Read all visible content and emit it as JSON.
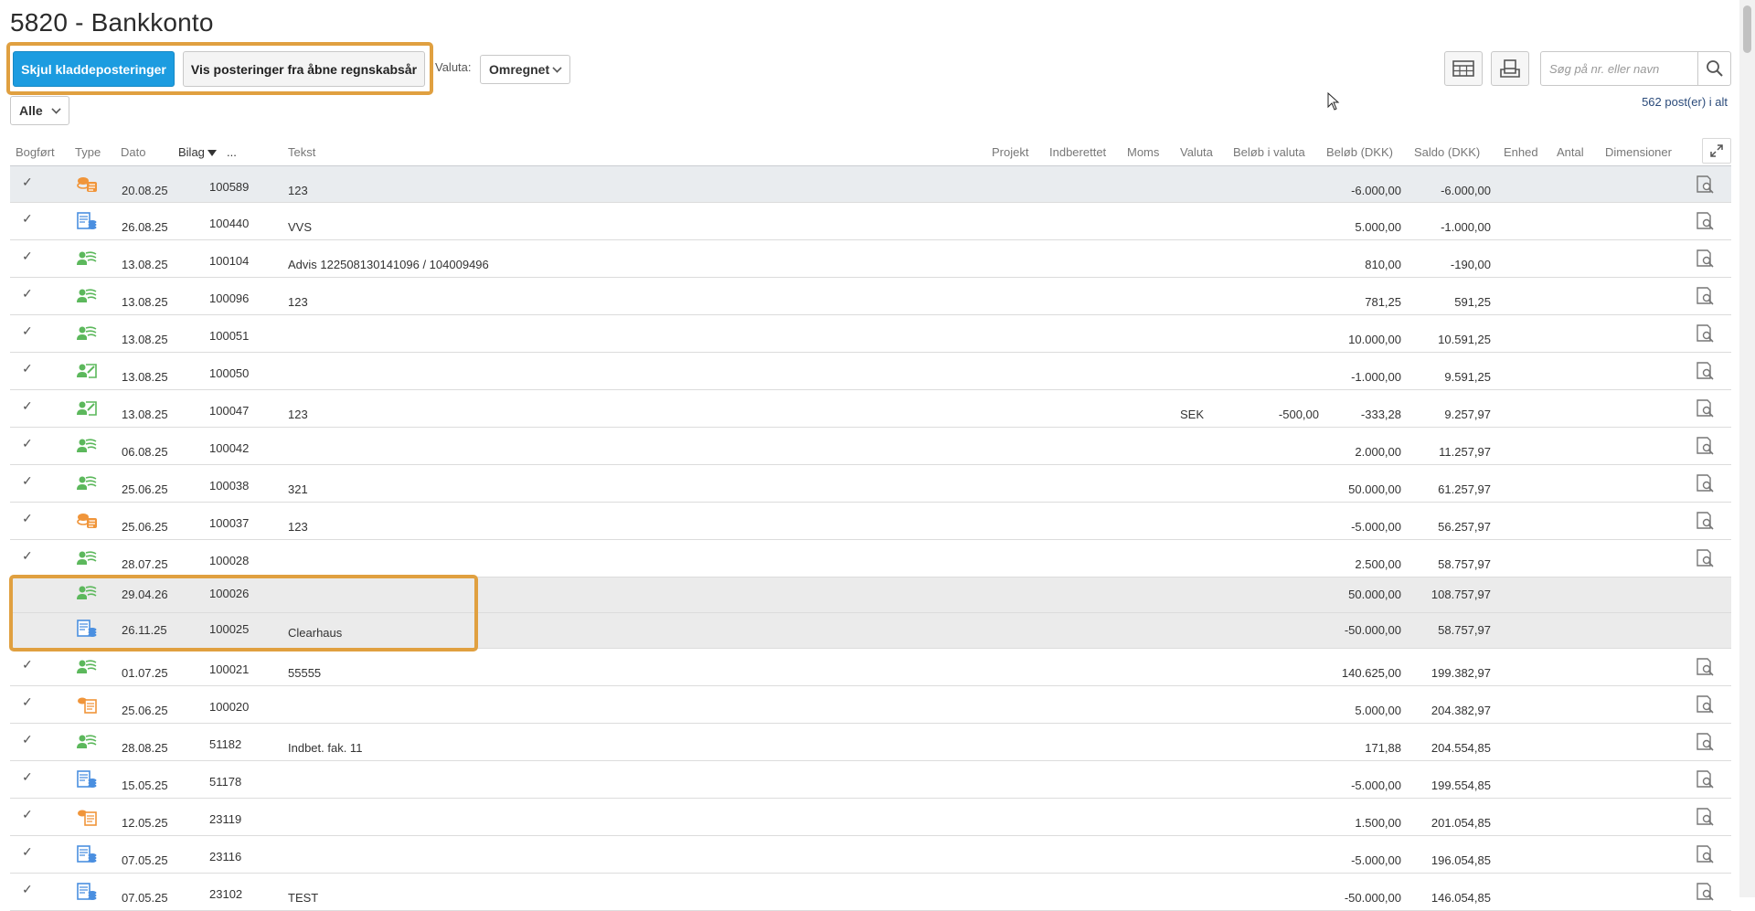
{
  "page": {
    "title": "5820 - Bankkonto"
  },
  "toolbar": {
    "hide_drafts_label": "Skjul kladdeposteringer",
    "show_open_years_label": "Vis posteringer fra åbne regnskabsår",
    "valuta_label": "Valuta:",
    "valuta_value": "Omregnet",
    "filter_value": "Alle",
    "search_placeholder": "Søg på nr. eller navn",
    "count_text": "562 post(er) i alt"
  },
  "columns": {
    "bogfort": "Bogført",
    "type": "Type",
    "dato": "Dato",
    "bilag": "Bilag",
    "more": "...",
    "tekst": "Tekst",
    "projekt": "Projekt",
    "indberettet": "Indberettet",
    "moms": "Moms",
    "valuta": "Valuta",
    "belob_valuta": "Beløb i valuta",
    "belob": "Beløb (DKK)",
    "saldo": "Saldo (DKK)",
    "enhed": "Enhed",
    "antal": "Antal",
    "dimensioner": "Dimensioner"
  },
  "rows": [
    {
      "check": "✓",
      "icon": "orange-coins-icon",
      "dato": "20.08.25",
      "bilag": "100589",
      "tekst": "123",
      "valuta": "",
      "belob_valuta": "",
      "belob": "-6.000,00",
      "saldo": "-6.000,00"
    },
    {
      "check": "✓",
      "icon": "blue-document-icon",
      "dato": "26.08.25",
      "bilag": "100440",
      "tekst": "VVS",
      "valuta": "",
      "belob_valuta": "",
      "belob": "5.000,00",
      "saldo": "-1.000,00"
    },
    {
      "check": "✓",
      "icon": "green-person-icon",
      "dato": "13.08.25",
      "bilag": "100104",
      "tekst": "Advis 122508130141096 / 104009496",
      "valuta": "",
      "belob_valuta": "",
      "belob": "810,00",
      "saldo": "-190,00"
    },
    {
      "check": "✓",
      "icon": "green-person-icon",
      "dato": "13.08.25",
      "bilag": "100096",
      "tekst": "123",
      "valuta": "",
      "belob_valuta": "",
      "belob": "781,25",
      "saldo": "591,25"
    },
    {
      "check": "✓",
      "icon": "green-person-icon",
      "dato": "13.08.25",
      "bilag": "100051",
      "tekst": "",
      "valuta": "",
      "belob_valuta": "",
      "belob": "10.000,00",
      "saldo": "10.591,25"
    },
    {
      "check": "✓",
      "icon": "green-edit-icon",
      "dato": "13.08.25",
      "bilag": "100050",
      "tekst": "",
      "valuta": "",
      "belob_valuta": "",
      "belob": "-1.000,00",
      "saldo": "9.591,25"
    },
    {
      "check": "✓",
      "icon": "green-edit-icon",
      "dato": "13.08.25",
      "bilag": "100047",
      "tekst": "123",
      "valuta": "SEK",
      "belob_valuta": "-500,00",
      "belob": "-333,28",
      "saldo": "9.257,97"
    },
    {
      "check": "✓",
      "icon": "green-person-icon",
      "dato": "06.08.25",
      "bilag": "100042",
      "tekst": "",
      "valuta": "",
      "belob_valuta": "",
      "belob": "2.000,00",
      "saldo": "11.257,97"
    },
    {
      "check": "✓",
      "icon": "green-person-icon",
      "dato": "25.06.25",
      "bilag": "100038",
      "tekst": "321",
      "valuta": "",
      "belob_valuta": "",
      "belob": "50.000,00",
      "saldo": "61.257,97"
    },
    {
      "check": "✓",
      "icon": "orange-coins-icon",
      "dato": "25.06.25",
      "bilag": "100037",
      "tekst": "123",
      "valuta": "",
      "belob_valuta": "",
      "belob": "-5.000,00",
      "saldo": "56.257,97"
    },
    {
      "check": "✓",
      "icon": "green-person-icon",
      "dato": "28.07.25",
      "bilag": "100028",
      "tekst": "",
      "valuta": "",
      "belob_valuta": "",
      "belob": "2.500,00",
      "saldo": "58.757,97"
    },
    {
      "check": "",
      "icon": "green-person-icon",
      "dato": "29.04.26",
      "bilag": "100026",
      "tekst": "",
      "valuta": "",
      "belob_valuta": "",
      "belob": "50.000,00",
      "saldo": "108.757,97"
    },
    {
      "check": "",
      "icon": "blue-document-icon",
      "dato": "26.11.25",
      "bilag": "100025",
      "tekst": "Clearhaus",
      "valuta": "",
      "belob_valuta": "",
      "belob": "-50.000,00",
      "saldo": "58.757,97"
    },
    {
      "check": "✓",
      "icon": "green-person-icon",
      "dato": "01.07.25",
      "bilag": "100021",
      "tekst": "55555",
      "valuta": "",
      "belob_valuta": "",
      "belob": "140.625,00",
      "saldo": "199.382,97"
    },
    {
      "check": "✓",
      "icon": "orange-invoice-icon",
      "dato": "25.06.25",
      "bilag": "100020",
      "tekst": "",
      "valuta": "",
      "belob_valuta": "",
      "belob": "5.000,00",
      "saldo": "204.382,97"
    },
    {
      "check": "✓",
      "icon": "green-person-icon",
      "dato": "28.08.25",
      "bilag": "51182",
      "tekst": "Indbet. fak. 11",
      "valuta": "",
      "belob_valuta": "",
      "belob": "171,88",
      "saldo": "204.554,85"
    },
    {
      "check": "✓",
      "icon": "blue-document-icon",
      "dato": "15.05.25",
      "bilag": "51178",
      "tekst": "",
      "valuta": "",
      "belob_valuta": "",
      "belob": "-5.000,00",
      "saldo": "199.554,85"
    },
    {
      "check": "✓",
      "icon": "orange-invoice-icon",
      "dato": "12.05.25",
      "bilag": "23119",
      "tekst": "",
      "valuta": "",
      "belob_valuta": "",
      "belob": "1.500,00",
      "saldo": "201.054,85"
    },
    {
      "check": "✓",
      "icon": "blue-document-icon",
      "dato": "07.05.25",
      "bilag": "23116",
      "tekst": "",
      "valuta": "",
      "belob_valuta": "",
      "belob": "-5.000,00",
      "saldo": "196.054,85"
    },
    {
      "check": "✓",
      "icon": "blue-document-icon",
      "dato": "07.05.25",
      "bilag": "23102",
      "tekst": "TEST",
      "valuta": "",
      "belob_valuta": "",
      "belob": "-50.000,00",
      "saldo": "146.054,85"
    }
  ],
  "colors": {
    "primary": "#1c9ce0",
    "highlight": "#e0a040",
    "green_icon": "#5cb85c",
    "orange_icon": "#f0953a",
    "blue_icon": "#4a8fe0"
  }
}
